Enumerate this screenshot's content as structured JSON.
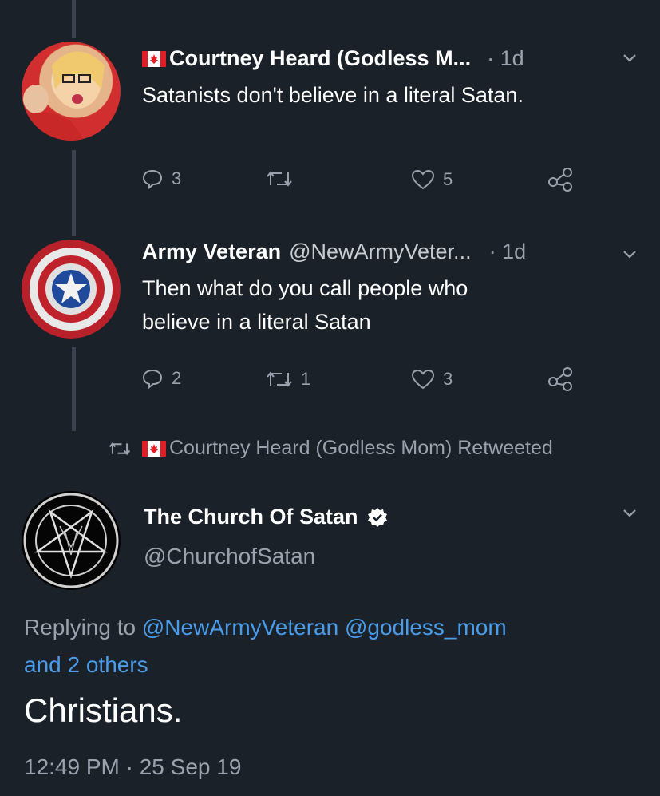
{
  "tweets": [
    {
      "name": "Courtney Heard (Godless M...",
      "time": "· 1d",
      "text": "Satanists don't believe in a literal Satan.",
      "replies": "3",
      "retweets": "",
      "likes": "5"
    },
    {
      "name": "Army Veteran",
      "handle": "@NewArmyVeter...",
      "time": "· 1d",
      "text_line1": "Then what do you call people who",
      "text_line2": "believe in a literal Satan",
      "replies": "2",
      "retweets": "1",
      "likes": "3"
    }
  ],
  "retweet_banner": "Courtney Heard (Godless Mom) Retweeted",
  "main_tweet": {
    "name": "The Church Of Satan",
    "handle": "@ChurchofSatan",
    "replying_label": "Replying to",
    "mention1": "@NewArmyVeteran",
    "mention2": "@godless_mom",
    "others": "and 2 others",
    "text": "Christians.",
    "timestamp": "12:49 PM · 25 Sep 19"
  },
  "icons": [
    "flag-canada-icon",
    "reply-icon",
    "retweet-icon",
    "like-icon",
    "share-icon",
    "chevron-down-icon",
    "verified-icon",
    "pentagram-icon"
  ],
  "colors": {
    "background": "#1b2129",
    "link": "#4a9ce8",
    "muted": "#9aa3ad"
  }
}
